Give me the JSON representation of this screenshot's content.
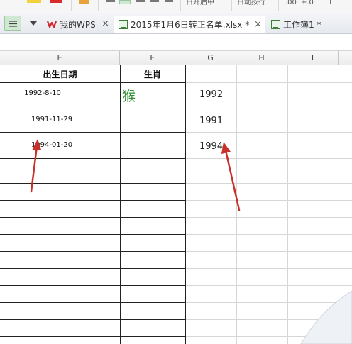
{
  "tabs": [
    {
      "label": "我的WPS",
      "active": false,
      "icon": "wps-logo-icon"
    },
    {
      "label": "2015年1月6日转正名单.xlsx *",
      "active": true,
      "icon": "spreadsheet-icon"
    },
    {
      "label": "工作簿1 *",
      "active": false,
      "icon": "spreadsheet-icon"
    }
  ],
  "ribbon": {
    "text_left": "日开后中",
    "text_right": "日动按行",
    "number_format_1": ".00",
    "number_format_2": "+.0"
  },
  "columns": [
    "E",
    "F",
    "G",
    "H",
    "I"
  ],
  "table": {
    "header_birthdate": "出生日期",
    "header_zodiac": "生肖",
    "rows": [
      {
        "birthdate": "1992-8-10",
        "zodiac": "猴",
        "year": "1992"
      },
      {
        "birthdate": "1991-11-29",
        "zodiac": "",
        "year": "1991"
      },
      {
        "birthdate": "1994-01-20",
        "zodiac": "",
        "year": "1994"
      }
    ]
  },
  "colors": {
    "accent_green": "#2f8f2f",
    "arrow_red": "#c8302a",
    "tab_active": "#ffffff"
  }
}
